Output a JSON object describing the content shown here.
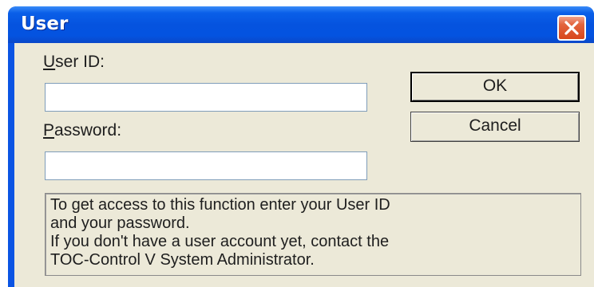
{
  "window": {
    "title": "User",
    "close_icon": "close-icon"
  },
  "form": {
    "userid_label_mnemonic": "U",
    "userid_label_rest": "ser ID:",
    "userid_value": "",
    "password_label_mnemonic": "P",
    "password_label_rest": "assword:",
    "password_value": ""
  },
  "buttons": {
    "ok_label": "OK",
    "cancel_label": "Cancel"
  },
  "info": {
    "text": "To get access to this function enter your User ID\nand your password.\nIf you don't have a user account yet, contact the\nTOC-Control V System Administrator."
  },
  "colors": {
    "titlebar": "#0553df",
    "client_bg": "#ece9d8",
    "close_button": "#d8471c"
  }
}
